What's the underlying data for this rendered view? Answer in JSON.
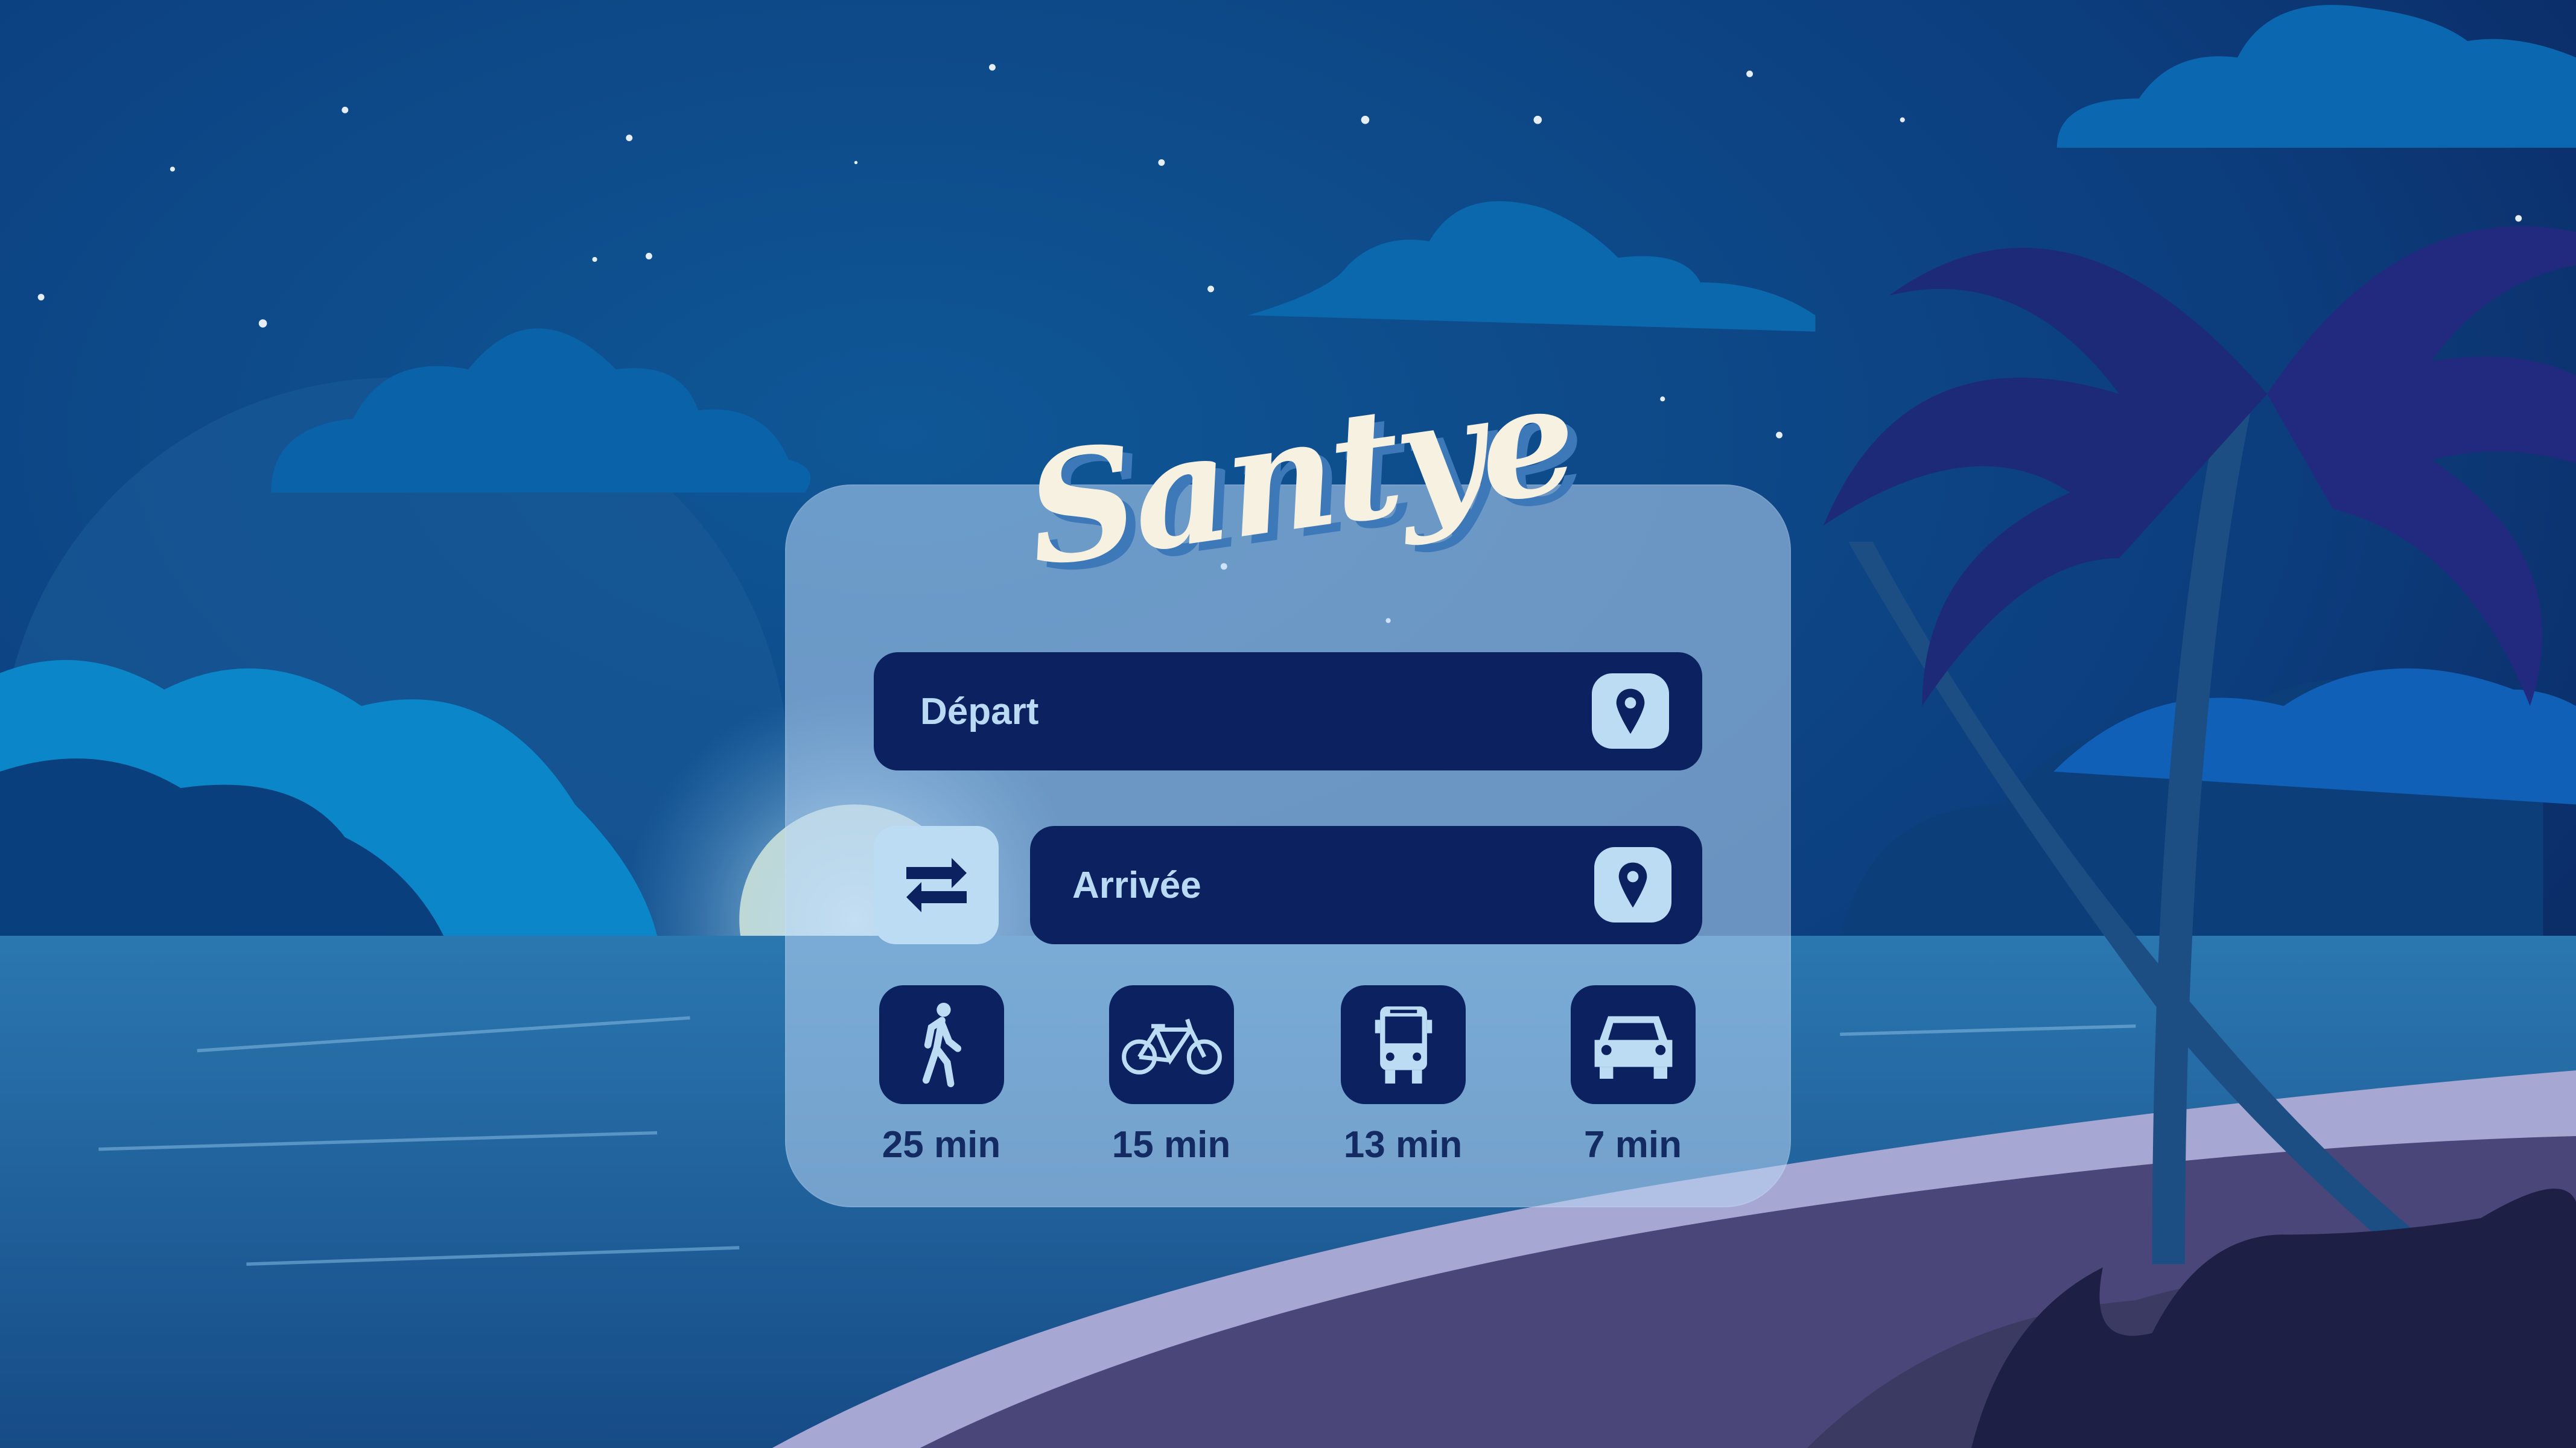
{
  "app": {
    "name": "Santye"
  },
  "route": {
    "departure": {
      "placeholder": "Départ",
      "icon": "map-pin-icon"
    },
    "arrival": {
      "placeholder": "Arrivée",
      "icon": "map-pin-icon"
    },
    "swap_icon": "swap-arrows-icon"
  },
  "modes": [
    {
      "name": "walk",
      "icon": "walking-icon",
      "duration": "25 min"
    },
    {
      "name": "bike",
      "icon": "bicycle-icon",
      "duration": "15 min"
    },
    {
      "name": "bus",
      "icon": "bus-icon",
      "duration": "13 min"
    },
    {
      "name": "car",
      "icon": "car-icon",
      "duration": "7 min"
    }
  ],
  "colors": {
    "field": "#0b2160",
    "accent": "#bcdcf3",
    "logo": "#f6f1e0"
  }
}
